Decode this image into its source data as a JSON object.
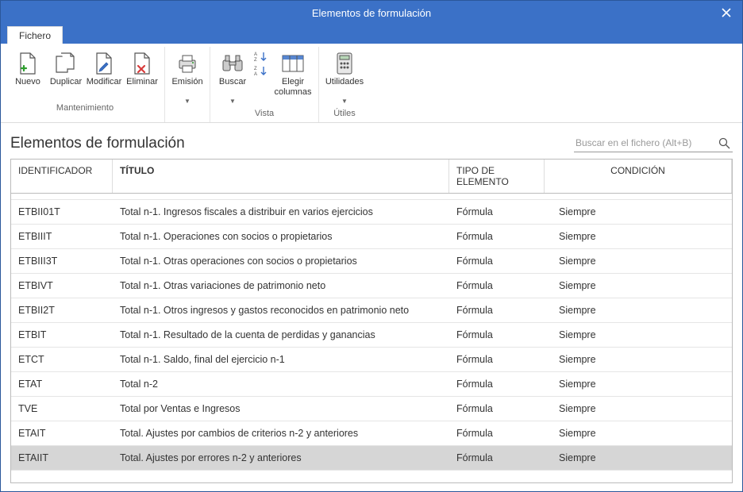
{
  "window": {
    "title": "Elementos de formulación"
  },
  "tabs": {
    "file": "Fichero"
  },
  "ribbon": {
    "maintenance": {
      "title": "Mantenimiento",
      "new": "Nuevo",
      "duplicate": "Duplicar",
      "modify": "Modificar",
      "delete": "Eliminar"
    },
    "emission": {
      "label": "Emisión"
    },
    "view": {
      "title": "Vista",
      "search": "Buscar",
      "columns": "Elegir columnas"
    },
    "utils": {
      "title": "Útiles",
      "utilities": "Utilidades"
    }
  },
  "page": {
    "title": "Elementos de formulación",
    "search_placeholder": "Buscar en el fichero (Alt+B)"
  },
  "columns": {
    "id": "IDENTIFICADOR",
    "title": "TÍTULO",
    "type": "TIPO DE ELEMENTO",
    "cond": "CONDICIÓN"
  },
  "rows": [
    {
      "id": "ETBII01T",
      "title": "Total n-1. Ingresos fiscales a distribuir en varios ejercicios",
      "type": "Fórmula",
      "cond": "Siempre",
      "selected": false
    },
    {
      "id": "ETBIIIT",
      "title": "Total n-1. Operaciones con socios o propietarios",
      "type": "Fórmula",
      "cond": "Siempre",
      "selected": false
    },
    {
      "id": "ETBIII3T",
      "title": "Total n-1. Otras operaciones con socios o propietarios",
      "type": "Fórmula",
      "cond": "Siempre",
      "selected": false
    },
    {
      "id": "ETBIVT",
      "title": "Total n-1. Otras variaciones de patrimonio neto",
      "type": "Fórmula",
      "cond": "Siempre",
      "selected": false
    },
    {
      "id": "ETBII2T",
      "title": "Total n-1. Otros ingresos y gastos reconocidos en patrimonio neto",
      "type": "Fórmula",
      "cond": "Siempre",
      "selected": false
    },
    {
      "id": "ETBIT",
      "title": "Total n-1. Resultado de la cuenta de perdidas y ganancias",
      "type": "Fórmula",
      "cond": "Siempre",
      "selected": false
    },
    {
      "id": "ETCT",
      "title": "Total n-1. Saldo, final del ejercicio n-1",
      "type": "Fórmula",
      "cond": "Siempre",
      "selected": false
    },
    {
      "id": "ETAT",
      "title": "Total n-2",
      "type": "Fórmula",
      "cond": "Siempre",
      "selected": false
    },
    {
      "id": "TVE",
      "title": "Total por Ventas e Ingresos",
      "type": "Fórmula",
      "cond": "Siempre",
      "selected": false
    },
    {
      "id": "ETAIT",
      "title": "Total. Ajustes por cambios de criterios n-2 y anteriores",
      "type": "Fórmula",
      "cond": "Siempre",
      "selected": false
    },
    {
      "id": "ETAIIT",
      "title": "Total. Ajustes por errores  n-2 y anteriores",
      "type": "Fórmula",
      "cond": "Siempre",
      "selected": true
    }
  ]
}
